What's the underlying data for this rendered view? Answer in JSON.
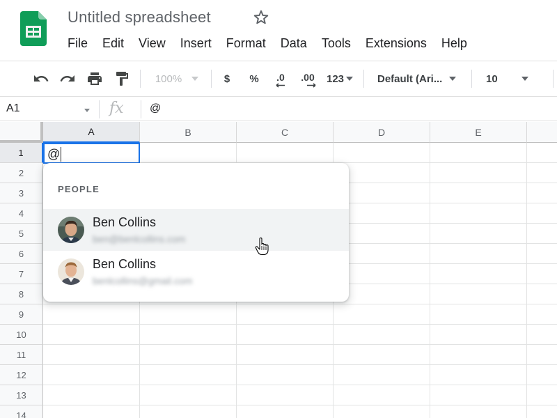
{
  "app": {
    "doc_title": "Untitled spreadsheet",
    "menu": [
      "File",
      "Edit",
      "View",
      "Insert",
      "Format",
      "Data",
      "Tools",
      "Extensions",
      "Help"
    ]
  },
  "toolbar": {
    "zoom": "100%",
    "currency": "$",
    "percent": "%",
    "decrease_decimal": ".0",
    "increase_decimal": ".00",
    "more_formats": "123",
    "font": "Default (Ari...",
    "font_size": "10"
  },
  "formula_bar": {
    "name_box": "A1",
    "fx": "fx",
    "content": "@"
  },
  "grid": {
    "columns": [
      "A",
      "B",
      "C",
      "D",
      "E"
    ],
    "rows": [
      "1",
      "2",
      "3",
      "4",
      "5",
      "6",
      "7",
      "8",
      "9",
      "10",
      "11",
      "12",
      "13",
      "14"
    ],
    "active_cell_value": "@"
  },
  "popup": {
    "heading": "PEOPLE",
    "people": [
      {
        "name": "Ben Collins",
        "email": "ben@benlcollins.com"
      },
      {
        "name": "Ben Collins",
        "email": "benlcollins@gmail.com"
      }
    ]
  },
  "colors": {
    "accent": "#1a73e8",
    "sheets_green": "#0f9d58",
    "hover": "#f1f3f4"
  },
  "icons": {
    "logo": "google-sheets-logo",
    "star": "star-outline-icon",
    "undo": "undo-icon",
    "redo": "redo-icon",
    "print": "print-icon",
    "paint_format": "paint-format-icon",
    "cursor": "hand-pointer-icon"
  }
}
